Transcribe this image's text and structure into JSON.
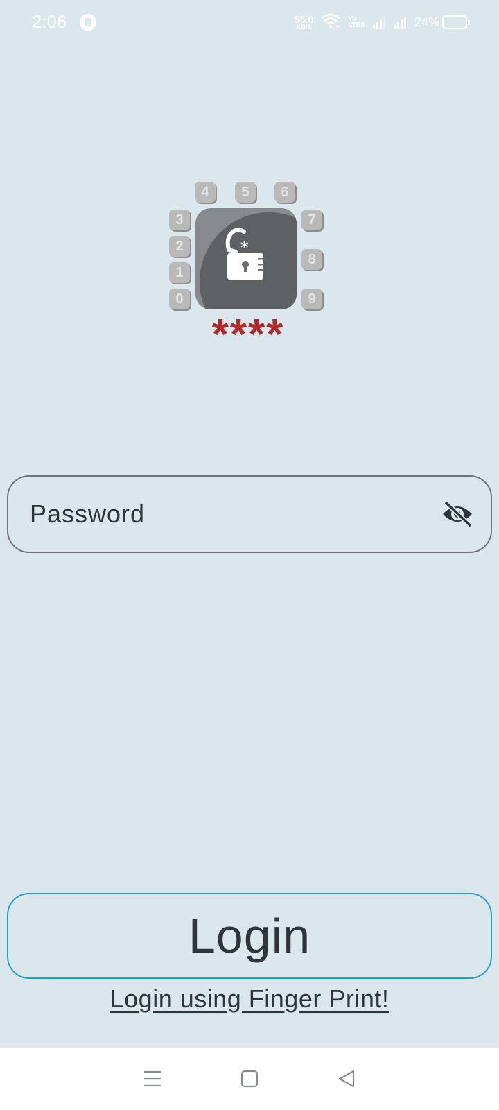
{
  "status_bar": {
    "time": "2:06",
    "net_speed_value": "55.0",
    "net_speed_unit": "KB/S",
    "volte_top": "Vo",
    "volte_bottom": "LTE8",
    "battery_percent": "24%",
    "battery_level": 0.24
  },
  "logo": {
    "keys": [
      "4",
      "5",
      "6",
      "3",
      "2",
      "1",
      "0",
      "7",
      "8",
      "9"
    ],
    "stars": "****"
  },
  "password": {
    "placeholder": "Password",
    "value": ""
  },
  "login_button": {
    "label": "Login"
  },
  "fingerprint_link": {
    "label": "Login using Finger Print!"
  },
  "nav_bar": {
    "icons": [
      "menu-icon",
      "home-square-icon",
      "back-triangle-icon"
    ]
  },
  "colors": {
    "background": "#dce6ed",
    "login_border": "#1ea0c8",
    "stars": "#b12a2a",
    "text": "#2f343b"
  }
}
